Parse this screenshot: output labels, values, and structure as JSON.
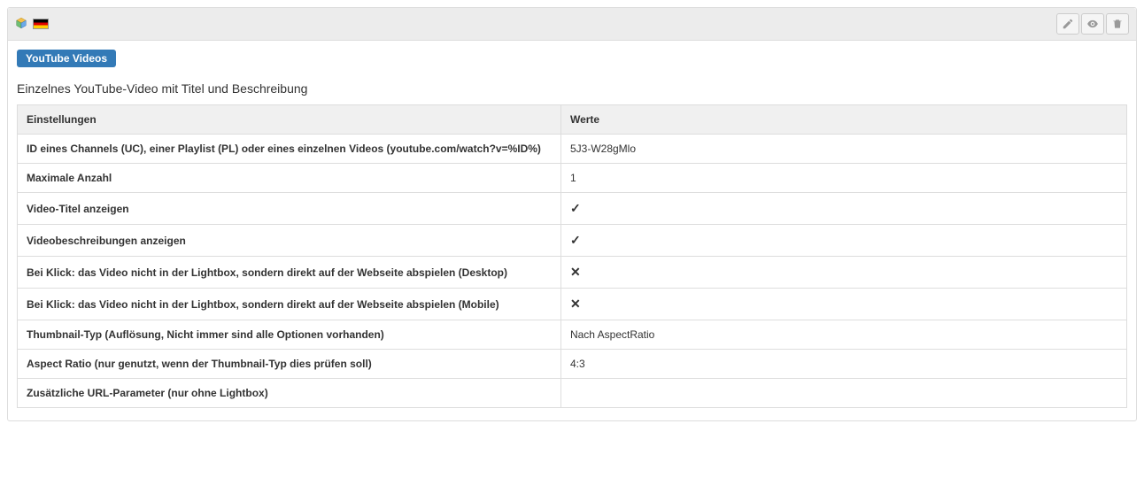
{
  "header": {
    "badge": "YouTube Videos",
    "title": "Einzelnes YouTube-Video mit Titel und Beschreibung"
  },
  "table": {
    "col_settings": "Einstellungen",
    "col_values": "Werte",
    "rows": [
      {
        "key": "ID eines Channels (UC), einer Playlist (PL) oder eines einzelnen Videos (youtube.com/watch?v=%ID%)",
        "val": "5J3-W28gMlo",
        "type": "text"
      },
      {
        "key": "Maximale Anzahl",
        "val": "1",
        "type": "text"
      },
      {
        "key": "Video-Titel anzeigen",
        "val": true,
        "type": "bool"
      },
      {
        "key": "Videobeschreibungen anzeigen",
        "val": true,
        "type": "bool"
      },
      {
        "key": "Bei Klick: das Video nicht in der Lightbox, sondern direkt auf der Webseite abspielen (Desktop)",
        "val": false,
        "type": "bool"
      },
      {
        "key": "Bei Klick: das Video nicht in der Lightbox, sondern direkt auf der Webseite abspielen (Mobile)",
        "val": false,
        "type": "bool"
      },
      {
        "key": "Thumbnail-Typ (Auflösung, Nicht immer sind alle Optionen vorhanden)",
        "val": "Nach AspectRatio",
        "type": "text"
      },
      {
        "key": "Aspect Ratio (nur genutzt, wenn der Thumbnail-Typ dies prüfen soll)",
        "val": "4:3",
        "type": "text"
      },
      {
        "key": "Zusätzliche URL-Parameter (nur ohne Lightbox)",
        "val": "",
        "type": "text"
      }
    ]
  }
}
